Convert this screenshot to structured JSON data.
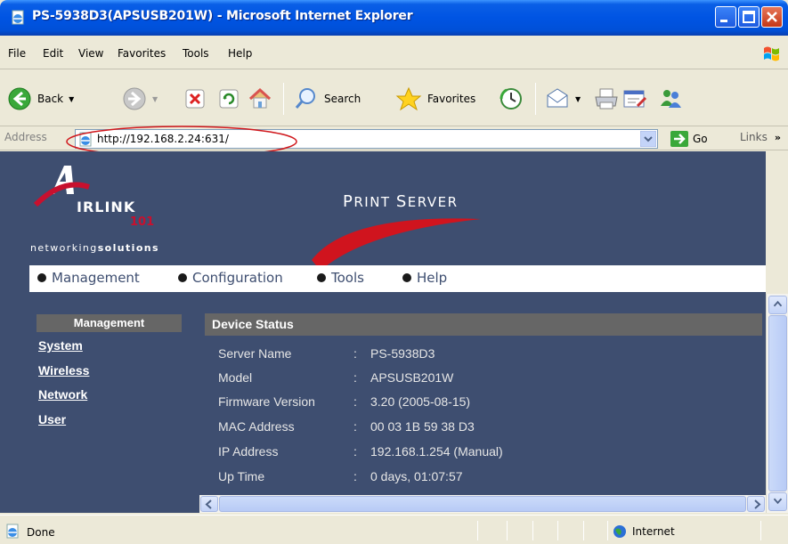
{
  "window": {
    "title": "PS-5938D3(APSUSB201W) - Microsoft Internet Explorer",
    "app_icon": "ie-page-icon",
    "title_bar_color": "#0054e3"
  },
  "menu": {
    "items": [
      "File",
      "Edit",
      "View",
      "Favorites",
      "Tools",
      "Help"
    ]
  },
  "toolbar": {
    "back_label": "Back",
    "search_label": "Search",
    "favorites_label": "Favorites"
  },
  "address": {
    "label": "Address",
    "url": "http://192.168.2.24:631/",
    "go_label": "Go",
    "links_label": "Links",
    "annotation_color": "#d0171c"
  },
  "page": {
    "background_color": "#3e4e70",
    "logo": {
      "word": "IRLINK",
      "number": "101",
      "tagline_prefix": "networking",
      "tagline_suffix": "solutions"
    },
    "product_title_small1": "P",
    "product_title_small1_rest": "RINT ",
    "product_title_small2": "S",
    "product_title_small2_rest": "ERVER",
    "nav": [
      "Management",
      "Configuration",
      "Tools",
      "Help"
    ],
    "sidebar": {
      "heading": "Management",
      "links": [
        "System",
        "Wireless",
        "Network",
        "User"
      ]
    },
    "device_status": {
      "heading": "Device Status",
      "rows": [
        {
          "label": "Server Name",
          "value": "PS-5938D3"
        },
        {
          "label": "Model",
          "value": "APSUSB201W"
        },
        {
          "label": "Firmware Version",
          "value": "3.20 (2005-08-15)"
        },
        {
          "label": "MAC Address",
          "value": "00 03 1B 59 38 D3"
        },
        {
          "label": "IP Address",
          "value": "192.168.1.254 (Manual)"
        },
        {
          "label": "Up Time",
          "value": "0 days, 01:07:57"
        }
      ],
      "separator": ":"
    }
  },
  "status": {
    "text": "Done",
    "zone": "Internet"
  }
}
